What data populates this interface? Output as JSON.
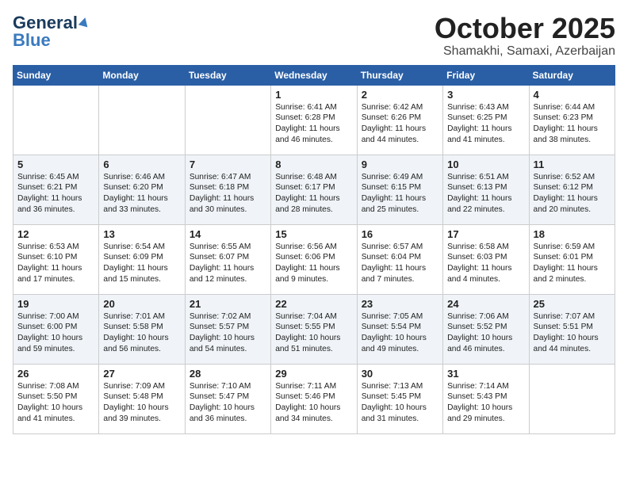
{
  "logo": {
    "part1": "General",
    "part2": "Blue"
  },
  "title": "October 2025",
  "location": "Shamakhi, Samaxi, Azerbaijan",
  "weekdays": [
    "Sunday",
    "Monday",
    "Tuesday",
    "Wednesday",
    "Thursday",
    "Friday",
    "Saturday"
  ],
  "weeks": [
    [
      {
        "day": "",
        "text": ""
      },
      {
        "day": "",
        "text": ""
      },
      {
        "day": "",
        "text": ""
      },
      {
        "day": "1",
        "text": "Sunrise: 6:41 AM\nSunset: 6:28 PM\nDaylight: 11 hours\nand 46 minutes."
      },
      {
        "day": "2",
        "text": "Sunrise: 6:42 AM\nSunset: 6:26 PM\nDaylight: 11 hours\nand 44 minutes."
      },
      {
        "day": "3",
        "text": "Sunrise: 6:43 AM\nSunset: 6:25 PM\nDaylight: 11 hours\nand 41 minutes."
      },
      {
        "day": "4",
        "text": "Sunrise: 6:44 AM\nSunset: 6:23 PM\nDaylight: 11 hours\nand 38 minutes."
      }
    ],
    [
      {
        "day": "5",
        "text": "Sunrise: 6:45 AM\nSunset: 6:21 PM\nDaylight: 11 hours\nand 36 minutes."
      },
      {
        "day": "6",
        "text": "Sunrise: 6:46 AM\nSunset: 6:20 PM\nDaylight: 11 hours\nand 33 minutes."
      },
      {
        "day": "7",
        "text": "Sunrise: 6:47 AM\nSunset: 6:18 PM\nDaylight: 11 hours\nand 30 minutes."
      },
      {
        "day": "8",
        "text": "Sunrise: 6:48 AM\nSunset: 6:17 PM\nDaylight: 11 hours\nand 28 minutes."
      },
      {
        "day": "9",
        "text": "Sunrise: 6:49 AM\nSunset: 6:15 PM\nDaylight: 11 hours\nand 25 minutes."
      },
      {
        "day": "10",
        "text": "Sunrise: 6:51 AM\nSunset: 6:13 PM\nDaylight: 11 hours\nand 22 minutes."
      },
      {
        "day": "11",
        "text": "Sunrise: 6:52 AM\nSunset: 6:12 PM\nDaylight: 11 hours\nand 20 minutes."
      }
    ],
    [
      {
        "day": "12",
        "text": "Sunrise: 6:53 AM\nSunset: 6:10 PM\nDaylight: 11 hours\nand 17 minutes."
      },
      {
        "day": "13",
        "text": "Sunrise: 6:54 AM\nSunset: 6:09 PM\nDaylight: 11 hours\nand 15 minutes."
      },
      {
        "day": "14",
        "text": "Sunrise: 6:55 AM\nSunset: 6:07 PM\nDaylight: 11 hours\nand 12 minutes."
      },
      {
        "day": "15",
        "text": "Sunrise: 6:56 AM\nSunset: 6:06 PM\nDaylight: 11 hours\nand 9 minutes."
      },
      {
        "day": "16",
        "text": "Sunrise: 6:57 AM\nSunset: 6:04 PM\nDaylight: 11 hours\nand 7 minutes."
      },
      {
        "day": "17",
        "text": "Sunrise: 6:58 AM\nSunset: 6:03 PM\nDaylight: 11 hours\nand 4 minutes."
      },
      {
        "day": "18",
        "text": "Sunrise: 6:59 AM\nSunset: 6:01 PM\nDaylight: 11 hours\nand 2 minutes."
      }
    ],
    [
      {
        "day": "19",
        "text": "Sunrise: 7:00 AM\nSunset: 6:00 PM\nDaylight: 10 hours\nand 59 minutes."
      },
      {
        "day": "20",
        "text": "Sunrise: 7:01 AM\nSunset: 5:58 PM\nDaylight: 10 hours\nand 56 minutes."
      },
      {
        "day": "21",
        "text": "Sunrise: 7:02 AM\nSunset: 5:57 PM\nDaylight: 10 hours\nand 54 minutes."
      },
      {
        "day": "22",
        "text": "Sunrise: 7:04 AM\nSunset: 5:55 PM\nDaylight: 10 hours\nand 51 minutes."
      },
      {
        "day": "23",
        "text": "Sunrise: 7:05 AM\nSunset: 5:54 PM\nDaylight: 10 hours\nand 49 minutes."
      },
      {
        "day": "24",
        "text": "Sunrise: 7:06 AM\nSunset: 5:52 PM\nDaylight: 10 hours\nand 46 minutes."
      },
      {
        "day": "25",
        "text": "Sunrise: 7:07 AM\nSunset: 5:51 PM\nDaylight: 10 hours\nand 44 minutes."
      }
    ],
    [
      {
        "day": "26",
        "text": "Sunrise: 7:08 AM\nSunset: 5:50 PM\nDaylight: 10 hours\nand 41 minutes."
      },
      {
        "day": "27",
        "text": "Sunrise: 7:09 AM\nSunset: 5:48 PM\nDaylight: 10 hours\nand 39 minutes."
      },
      {
        "day": "28",
        "text": "Sunrise: 7:10 AM\nSunset: 5:47 PM\nDaylight: 10 hours\nand 36 minutes."
      },
      {
        "day": "29",
        "text": "Sunrise: 7:11 AM\nSunset: 5:46 PM\nDaylight: 10 hours\nand 34 minutes."
      },
      {
        "day": "30",
        "text": "Sunrise: 7:13 AM\nSunset: 5:45 PM\nDaylight: 10 hours\nand 31 minutes."
      },
      {
        "day": "31",
        "text": "Sunrise: 7:14 AM\nSunset: 5:43 PM\nDaylight: 10 hours\nand 29 minutes."
      },
      {
        "day": "",
        "text": ""
      }
    ]
  ]
}
